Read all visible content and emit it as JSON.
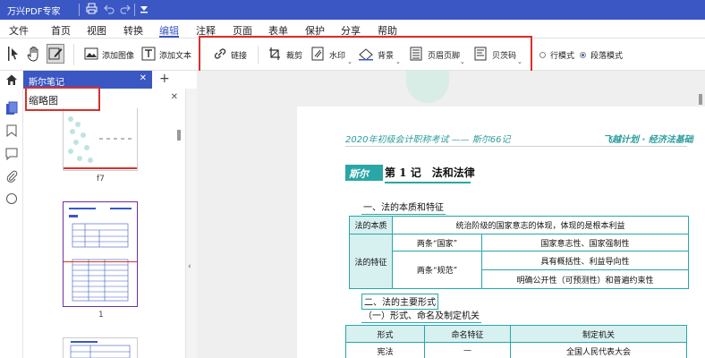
{
  "app": {
    "title": "万兴PDF专家"
  },
  "quick_access": {
    "print_icon": "print-icon",
    "undo_icon": "undo-icon",
    "redo_icon": "redo-icon",
    "more_icon": "dropdown-icon"
  },
  "menu": {
    "items": [
      "文件",
      "首页",
      "视图",
      "转换",
      "编辑",
      "注释",
      "页面",
      "表单",
      "保护",
      "分享",
      "帮助"
    ],
    "active": "编辑"
  },
  "toolbar": {
    "select_tool": "cursor-icon",
    "hand_tool": "hand-icon",
    "edit_tool": "edit-icon",
    "add_image": "添加图像",
    "add_text": "添加文本",
    "link": "链接",
    "crop": "裁剪",
    "watermark": "水印",
    "background": "背景",
    "header_footer": "页眉页脚",
    "bates": "贝茨码",
    "line_mode": "行模式",
    "paragraph_mode": "段落模式",
    "selected_mode": "段落模式"
  },
  "tabs": {
    "document": "斯尔笔记",
    "add": "+"
  },
  "thumbnails": {
    "title": "缩略图",
    "pages": [
      {
        "label": "f7"
      },
      {
        "label": "1"
      }
    ]
  },
  "document": {
    "header_left": "2020年初级会计职称考试 —— 斯尔66记",
    "header_right": "飞越计划 · 经济法基础",
    "brand": "斯尔",
    "chapter": "第 1 记　法和法律",
    "section1": "一、法的本质和特征",
    "table1": {
      "row1_label": "法的本质",
      "row1_value": "统治阶级的国家意志的体现，体现的是根本利益",
      "row2_label": "法的特征",
      "sub1": "两条“国家”",
      "sub1_a": "国家意志性、国家强制性",
      "sub2": "两条“规范”",
      "sub2_a": "具有概括性、利益导向性",
      "sub2_b": "明确公开性（可预测性）和普遍约束性"
    },
    "section2": "二、法的主要形式",
    "section2_sub": "（一）形式、命名及制定机关",
    "table2": {
      "headers": [
        "形式",
        "命名特征",
        "制定机关"
      ],
      "row1": [
        "宪法",
        "—",
        "全国人民代表大会"
      ]
    }
  },
  "colors": {
    "accent": "#3a57c4",
    "teal": "#2aa6a6",
    "highlight": "#d9302c"
  }
}
